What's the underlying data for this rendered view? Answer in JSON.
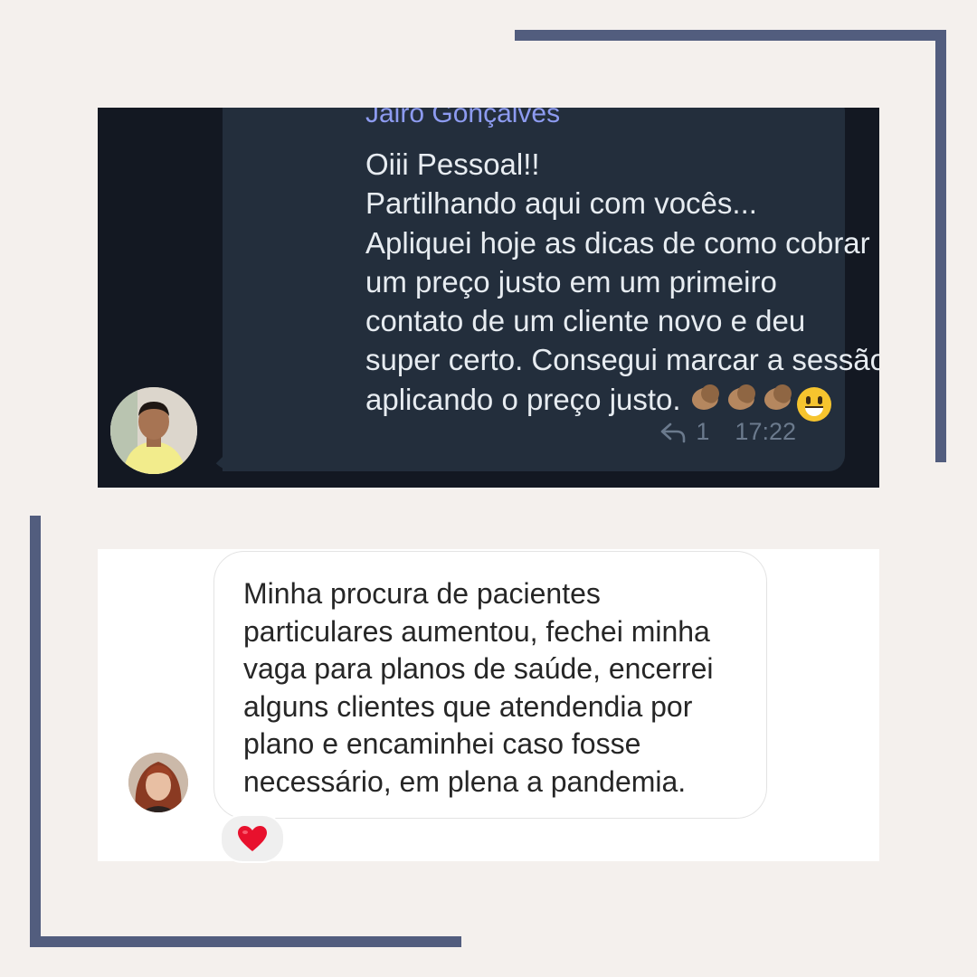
{
  "chat1": {
    "sender": "Jairo Gonçalves",
    "message": "Oiii Pessoal!!\nPartilhando aqui com vocês...\nApliquei hoje as dicas de como cobrar\num preço justo em um primeiro\ncontato de um cliente novo e deu\nsuper certo. Consegui marcar a sessão\naplicando o preço justo.",
    "emojis": [
      "clapping-hands-icon",
      "clapping-hands-icon",
      "clapping-hands-icon",
      "grinning-face-icon"
    ],
    "reply_count": "1",
    "time": "17:22"
  },
  "chat2": {
    "message": "Minha procura de pacientes\nparticulares aumentou, fechei minha\nvaga para planos de saúde, encerrei\nalguns clientes que atendendia por\nplano e encaminhei caso fosse\nnecessário, em plena a pandemia.",
    "reaction": "heart-icon"
  },
  "colors": {
    "frame": "#525d7e",
    "dark_bg": "#131822",
    "dark_bubble": "#232e3c",
    "sender_name": "#8d9bf0",
    "background": "#f4f0ed"
  }
}
